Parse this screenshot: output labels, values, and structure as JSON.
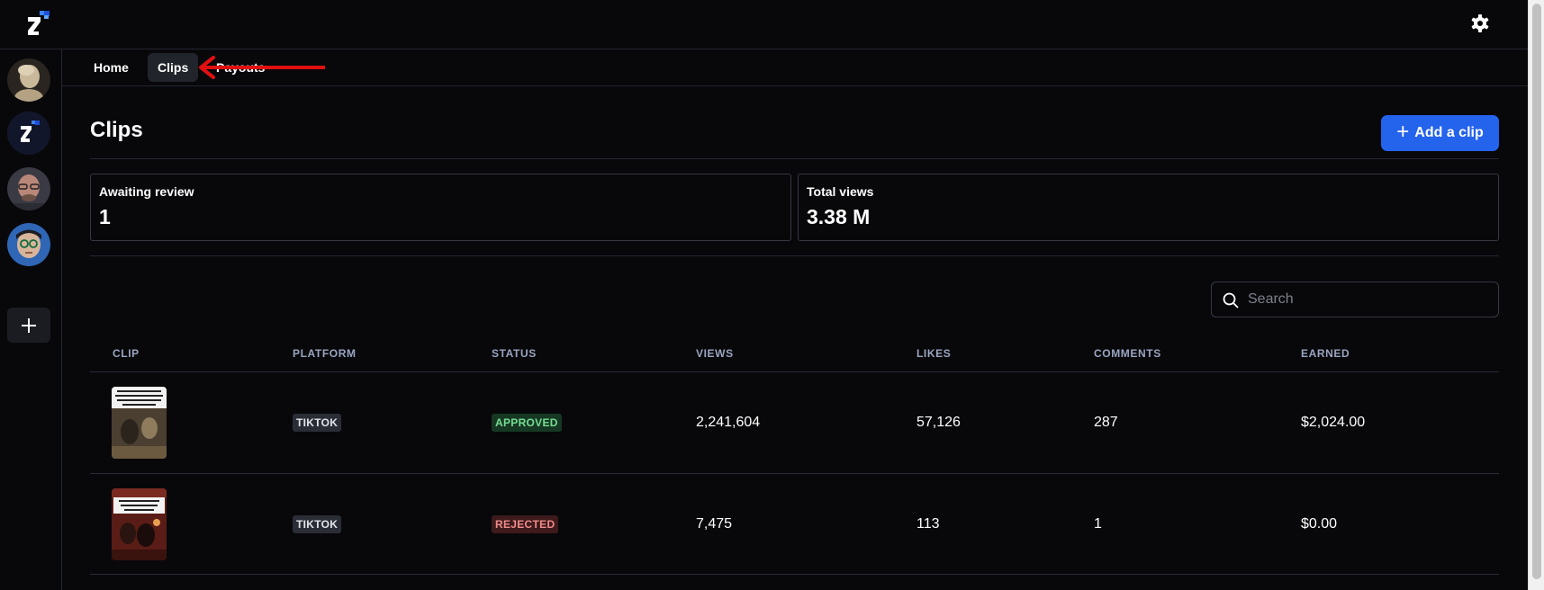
{
  "nav": {
    "tabs": [
      {
        "label": "Home"
      },
      {
        "label": "Clips"
      },
      {
        "label": "Payouts"
      }
    ]
  },
  "icons": {
    "logo": "brand-logo-icon",
    "settings": "gear-icon",
    "add_workspace": "plus-icon",
    "search": "search-icon",
    "annotation": "red-arrow-pointing-left"
  },
  "colors": {
    "background": "#08080b",
    "accent": "#2463eb",
    "approved": "#77dd93",
    "rejected": "#ef8a8a",
    "annotation": "#e01010"
  },
  "page": {
    "title": "Clips",
    "add_button_label": "Add a clip"
  },
  "stats": {
    "awaiting_review_label": "Awaiting review",
    "awaiting_review_value": "1",
    "total_views_label": "Total views",
    "total_views_value": "3.38 M"
  },
  "search": {
    "placeholder": "Search"
  },
  "table": {
    "columns": [
      "CLIP",
      "PLATFORM",
      "STATUS",
      "VIEWS",
      "LIKES",
      "COMMENTS",
      "EARNED"
    ],
    "rows": [
      {
        "platform": "TIKTOK",
        "status": "APPROVED",
        "views": "2,241,604",
        "likes": "57,126",
        "comments": "287",
        "earned": "$2,024.00"
      },
      {
        "platform": "TIKTOK",
        "status": "REJECTED",
        "views": "7,475",
        "likes": "113",
        "comments": "1",
        "earned": "$0.00"
      }
    ]
  }
}
